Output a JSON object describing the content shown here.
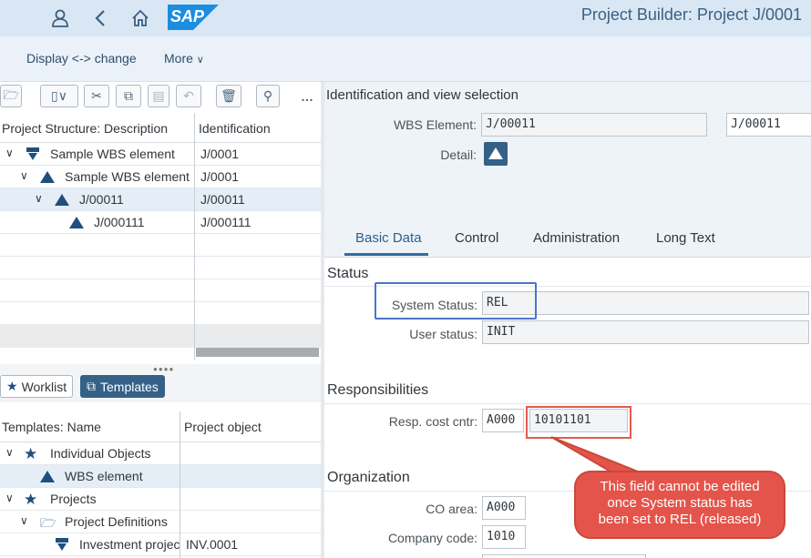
{
  "shell": {
    "title": "Project Builder: Project J/0001",
    "logo_text": "SAP"
  },
  "subheader": {
    "display_change": "Display <-> change",
    "more": "More"
  },
  "tree": {
    "col1": "Project Structure: Description",
    "col2": "Identification",
    "rows": [
      {
        "desc": "Sample WBS element",
        "id": "J/0001"
      },
      {
        "desc": "Sample WBS element",
        "id": "J/0001"
      },
      {
        "desc": "J/00011",
        "id": "J/00011"
      },
      {
        "desc": "J/000111",
        "id": "J/000111"
      }
    ]
  },
  "bottom_tabs": {
    "worklist": "Worklist",
    "templates": "Templates"
  },
  "templates": {
    "col1": "Templates: Name",
    "col2": "Project object",
    "rows": [
      {
        "name": "Individual Objects",
        "obj": ""
      },
      {
        "name": "WBS element",
        "obj": ""
      },
      {
        "name": "Projects",
        "obj": ""
      },
      {
        "name": "Project Definitions",
        "obj": ""
      },
      {
        "name": "Investment projec",
        "obj": "INV.0001"
      }
    ]
  },
  "ident": {
    "heading": "Identification and view selection",
    "wbs_label": "WBS Element:",
    "wbs_value": "J/00011",
    "wbs_value2": "J/00011",
    "detail_label": "Detail:"
  },
  "tabs": [
    "Basic Data",
    "Control",
    "Administration",
    "Long Text"
  ],
  "status": {
    "heading": "Status",
    "system_label": "System Status:",
    "system_value": "REL",
    "user_label": "User status:",
    "user_value": "INIT"
  },
  "resp": {
    "heading": "Responsibilities",
    "cost_label": "Resp. cost cntr:",
    "cost_area": "A000",
    "cost_value": "10101101"
  },
  "org": {
    "heading": "Organization",
    "co_label": "CO area:",
    "co_value": "A000",
    "company_label": "Company code:",
    "company_value": "1010"
  },
  "callout": {
    "line1": "This field cannot be edited",
    "line2": "once System status has",
    "line3": "been set to REL (released)"
  },
  "colors": {
    "shell_bg": "#d9e7f5",
    "accent": "#346187",
    "highlight": "#4a76c6",
    "callout": "#e4544a"
  }
}
